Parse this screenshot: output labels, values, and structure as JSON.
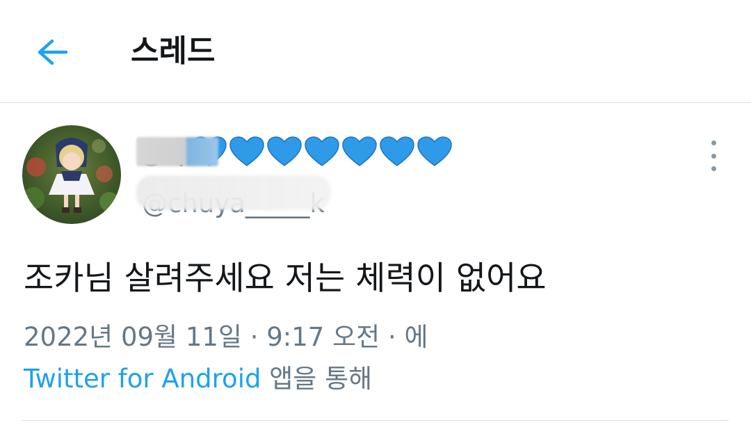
{
  "header": {
    "title": "스레드",
    "back_icon": "arrow-left-icon",
    "accent_color": "#1da1f2"
  },
  "tweet": {
    "author": {
      "display_name_visible": "동아",
      "display_name_emoji_count": 7,
      "emoji_icon": "blue-heart-icon",
      "handle": "@chuya_____k",
      "avatar": "doll-photo-avatar"
    },
    "more_icon": "more-vertical-icon",
    "text": "조카님 살려주세요 저는 체력이 없어요",
    "timestamp": "2022년 09월 11일 · 9:17 오전 · 에",
    "source_app": "Twitter for Android",
    "source_suffix": " 앱을 통해"
  }
}
